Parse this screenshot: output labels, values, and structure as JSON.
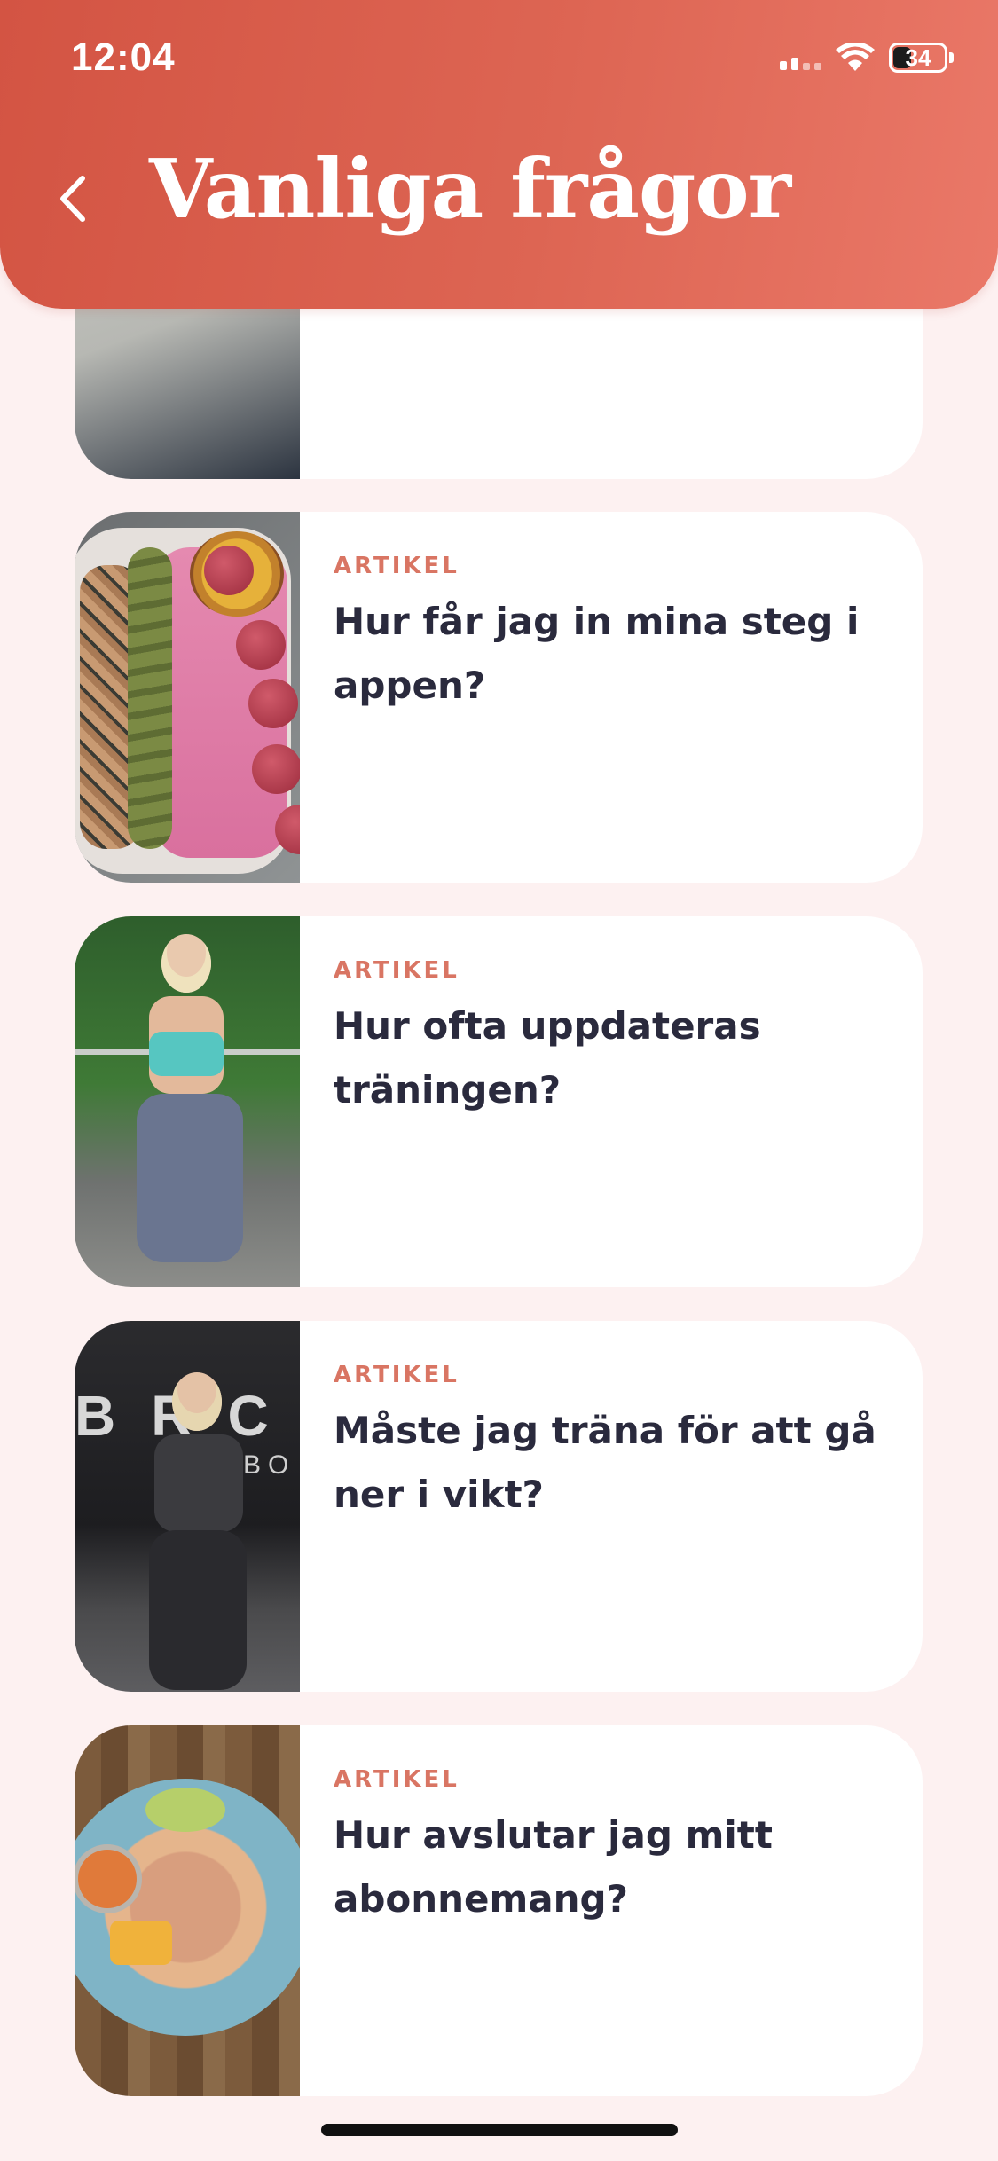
{
  "status_bar": {
    "time": "12:04",
    "battery_level": "34"
  },
  "header": {
    "title": "Vanliga frågor",
    "back_icon": "chevron-left-icon"
  },
  "articles": [
    {
      "label": "",
      "title": "",
      "image": "acai-bowl-hand"
    },
    {
      "label": "ARTIKEL",
      "title": "Hur får jag in mina steg i appen?",
      "image": "smoothie-bowl"
    },
    {
      "label": "ARTIKEL",
      "title": "Hur ofta uppdateras träningen?",
      "image": "woman-lunge-outdoor"
    },
    {
      "label": "ARTIKEL",
      "title": "Måste jag träna för att gå ner i vikt?",
      "image": "woman-dumbbells-gym"
    },
    {
      "label": "ARTIKEL",
      "title": "Hur avslutar jag mitt abonnemang?",
      "image": "poke-bowl"
    }
  ],
  "colors": {
    "header_start": "#d35443",
    "header_end": "#ea7868",
    "background": "#fdf1f1",
    "label": "#d97563",
    "title": "#2a2a3d"
  }
}
